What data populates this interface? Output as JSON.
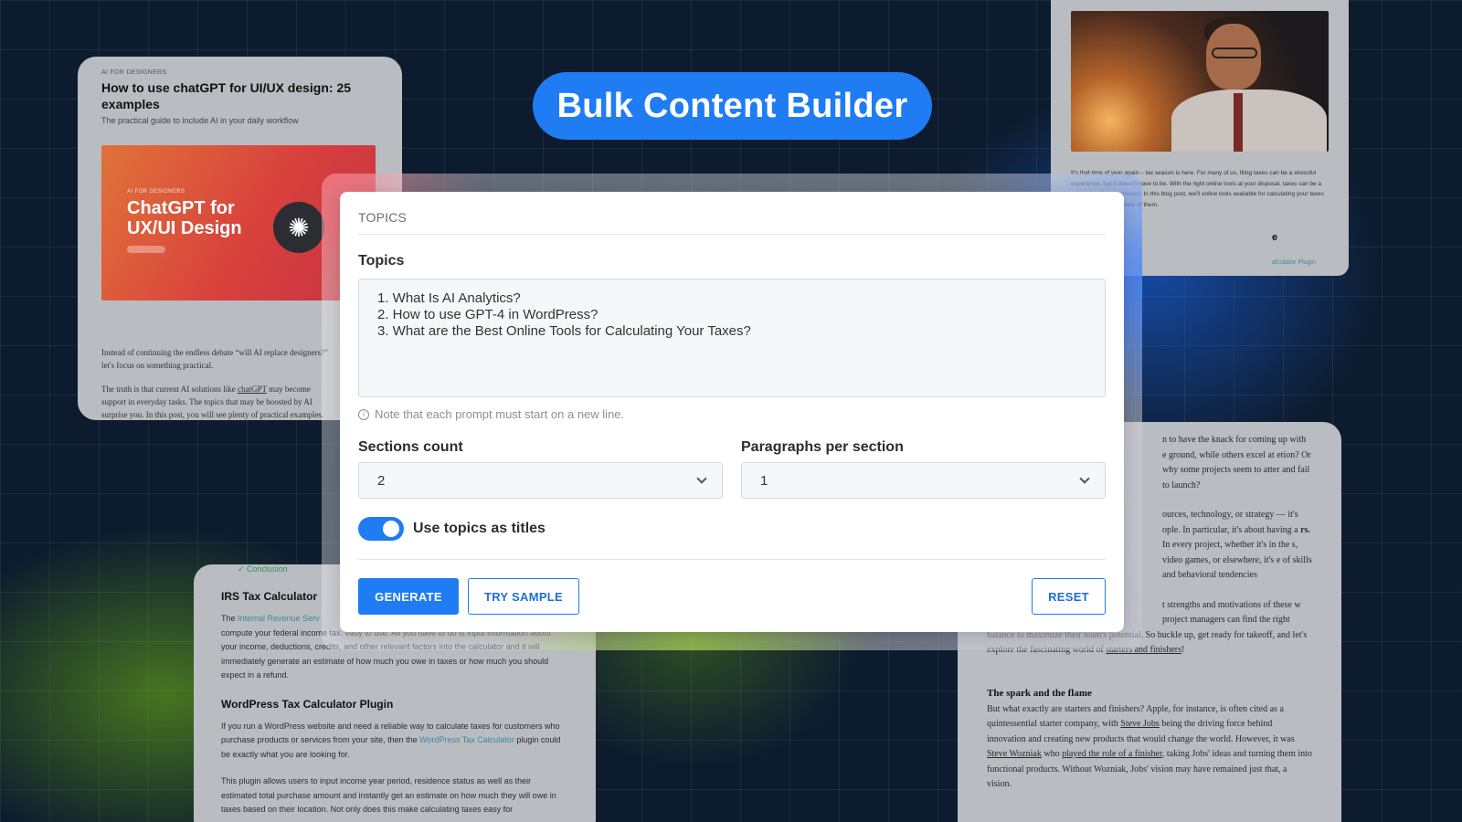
{
  "header": {
    "title": "Bulk Content Builder"
  },
  "bg_card_ai": {
    "kicker": "AI FOR DESIGNERS",
    "title": "How to use chatGPT for UI/UX design: 25 examples",
    "subtitle": "The practical guide to include AI in your daily workflow",
    "hero_kicker": "AI FOR DESIGNERS",
    "hero_title": "ChatGPT for UX/UI Design",
    "paragraph1": "Instead of continuing the endless debate “will AI replace designers?” let's focus on something practical.",
    "paragraph2_a": "The truth is that current AI solutions like ",
    "paragraph2_link": "chatGPT",
    "paragraph2_b": " may become support in everyday tasks. The topics that may be boosted by AI surprise you. In this post, you will see plenty of practical examples."
  },
  "bg_card_tax": {
    "text": "It's that time of year again – tax season is here. For many of us, filing taxes can be a stressful experience, but it doesn't have to be. With the right online tools at your disposal, taxes can be a relatively painless process. In this blog post, we'll online tools available for calculating your taxes and provide an overview of them.",
    "heading_fragment": "e",
    "link_fragment": "alculator Plugin"
  },
  "bg_card_irs": {
    "check_item": "✓ Conclusion",
    "heading1": "IRS Tax Calculator",
    "p1_a": "The ",
    "p1_link": "Internal Revenue Serv",
    "p1_b": "compute your federal income tax. easy to use. All you have to do is input information about your income, deductions, credits, and other relevant factors into the calculator and it will immediately generate an estimate of how much you owe in taxes or how much you should expect in a refund.",
    "heading2": "WordPress Tax Calculator Plugin",
    "p2_a": "If you run a WordPress website and need a reliable way to calculate taxes for customers who purchase products or services from your site, then the ",
    "p2_link": "WordPress Tax Calculator",
    "p2_b": " plugin could be exactly what you are looking for.",
    "p3": "This plugin allows users to input income year period, residence status as well as their estimated total purchase amount and instantly get an estimate on how much they will owe in taxes based on their location. Not only does this make calculating taxes easy for"
  },
  "bg_card_article": {
    "frag1": "n to have the knack for coming up with e ground, while others excel at etion? Or why some projects seem to atter and fail to launch?",
    "frag2_a": "ources, technology, or strategy — it's ople. In particular, it's about having a ",
    "frag2_bold": "rs.",
    "frag2_b": " In every project, whether it's in the s, video games, or elsewhere, it's e of skills and behavioral tendencies",
    "frag3": "t strengths and motivations of these w project managers can find the right",
    "p4_a": "balance to maximize their team's potential. So buckle up, get ready for takeoff, and let's explore the fascinating world of ",
    "p4_link": "starters and finishers",
    "p4_b": "!",
    "heading": "The spark and the flame",
    "p5_a": "But what exactly are starters and finishers? Apple, for instance, is often cited as a quintessential starter company, with ",
    "p5_link1": "Steve Jobs",
    "p5_b": " being the driving force behind innovation and creating new products that would change the world. However, it was ",
    "p5_link2": "Steve Wozniak",
    "p5_c": " who ",
    "p5_link3": "played the role of a finisher",
    "p5_d": ", taking Jobs' ideas and turning them into functional products. Without Wozniak, Jobs' vision may have remained just that, a vision."
  },
  "modal": {
    "section_header": "TOPICS",
    "topics_label": "Topics",
    "topics_lines": [
      "1. What Is AI Analytics?",
      "2. How to use GPT-4 in WordPress?",
      "3. What are the Best Online Tools for Calculating Your Taxes?"
    ],
    "helper_icon": "i",
    "helper_text": "Note that each prompt must start on a new line.",
    "sections_label": "Sections count",
    "sections_value": "2",
    "paragraphs_label": "Paragraphs per section",
    "paragraphs_value": "1",
    "toggle_label": "Use topics as titles",
    "toggle_on": true,
    "generate_label": "GENERATE",
    "sample_label": "TRY SAMPLE",
    "reset_label": "RESET"
  },
  "colors": {
    "accent": "#1f7cf2",
    "background": "#0d1b2e",
    "card_gray": "#b9bcc1"
  },
  "icons": {
    "info": "info-icon",
    "chevron": "chevron-down-icon",
    "openai_logo": "openai-logo-icon"
  }
}
